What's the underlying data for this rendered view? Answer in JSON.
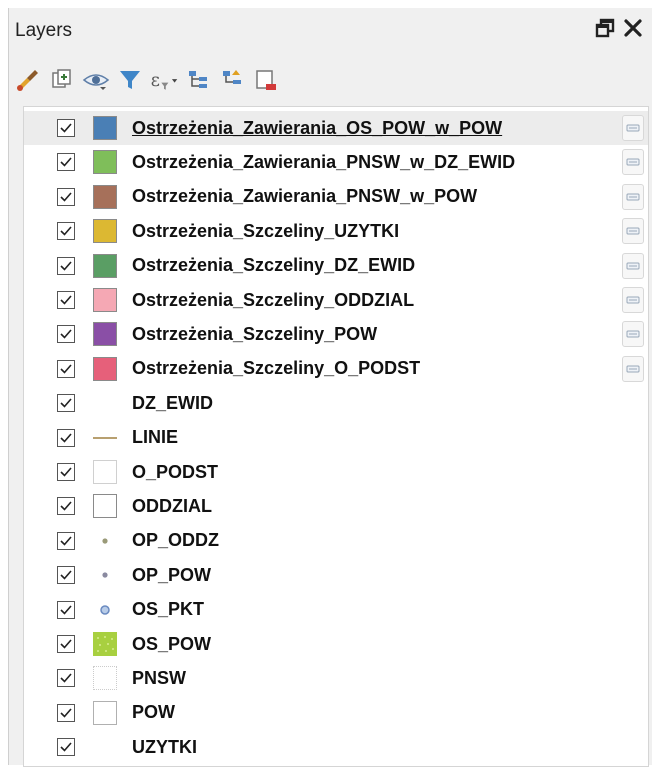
{
  "panel": {
    "title": "Layers",
    "float_icon": "float-panel-icon",
    "close_icon": "close-icon"
  },
  "toolbar": {
    "tools": [
      {
        "name": "style-manager-icon"
      },
      {
        "name": "add-group-icon"
      },
      {
        "name": "visibility-eye-icon"
      },
      {
        "name": "filter-legend-icon"
      },
      {
        "name": "filter-expression-icon"
      },
      {
        "name": "expand-all-icon"
      },
      {
        "name": "collapse-all-icon"
      },
      {
        "name": "remove-layer-icon"
      }
    ]
  },
  "layers": [
    {
      "label": "Ostrzeżenia_Zawierania_OS_POW_w_POW",
      "checked": true,
      "symbol": "fill",
      "color": "#4a7fb5",
      "indicator": true,
      "selected": true
    },
    {
      "label": "Ostrzeżenia_Zawierania_PNSW_w_DZ_EWID",
      "checked": true,
      "symbol": "fill",
      "color": "#7fbe5a",
      "indicator": true
    },
    {
      "label": "Ostrzeżenia_Zawierania_PNSW_w_POW",
      "checked": true,
      "symbol": "fill",
      "color": "#a6705a",
      "indicator": true
    },
    {
      "label": "Ostrzeżenia_Szczeliny_UZYTKI",
      "checked": true,
      "symbol": "fill",
      "color": "#dcb832",
      "indicator": true
    },
    {
      "label": "Ostrzeżenia_Szczeliny_DZ_EWID",
      "checked": true,
      "symbol": "fill",
      "color": "#5a9e64",
      "indicator": true
    },
    {
      "label": "Ostrzeżenia_Szczeliny_ODDZIAL",
      "checked": true,
      "symbol": "fill",
      "color": "#f5a8b4",
      "indicator": true
    },
    {
      "label": "Ostrzeżenia_Szczeliny_POW",
      "checked": true,
      "symbol": "fill",
      "color": "#8a4fa6",
      "indicator": true
    },
    {
      "label": "Ostrzeżenia_Szczeliny_O_PODST",
      "checked": true,
      "symbol": "fill",
      "color": "#e6607a",
      "indicator": true
    },
    {
      "label": "DZ_EWID",
      "checked": true,
      "symbol": "empty"
    },
    {
      "label": "LINIE",
      "checked": true,
      "symbol": "line",
      "color": "#a08040"
    },
    {
      "label": "O_PODST",
      "checked": true,
      "symbol": "outline",
      "color": "#d0d0d0"
    },
    {
      "label": "ODDZIAL",
      "checked": true,
      "symbol": "outline",
      "color": "#8a8a8a"
    },
    {
      "label": "OP_ODDZ",
      "checked": true,
      "symbol": "point",
      "color": "#9a9a78"
    },
    {
      "label": "OP_POW",
      "checked": true,
      "symbol": "point",
      "color": "#8a8aa0"
    },
    {
      "label": "OS_PKT",
      "checked": true,
      "symbol": "point-ring",
      "color": "#6a8ac0"
    },
    {
      "label": "OS_POW",
      "checked": true,
      "symbol": "pattern",
      "color": "#a8d040"
    },
    {
      "label": "PNSW",
      "checked": true,
      "symbol": "dotted",
      "color": "#cccccc"
    },
    {
      "label": "POW",
      "checked": true,
      "symbol": "outline",
      "color": "#b0b0b0"
    },
    {
      "label": "UZYTKI",
      "checked": true,
      "symbol": "empty"
    }
  ]
}
